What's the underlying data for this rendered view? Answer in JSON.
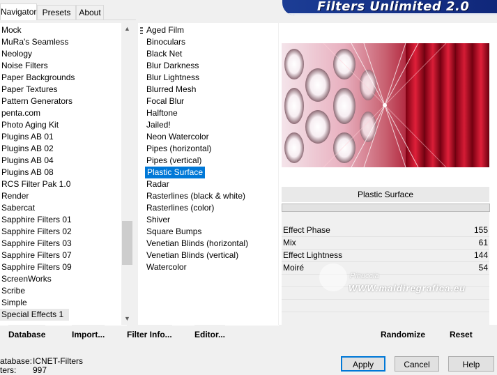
{
  "tabs": [
    {
      "label": "Navigator",
      "active": true
    },
    {
      "label": "Presets",
      "active": false
    },
    {
      "label": "About",
      "active": false
    }
  ],
  "banner_title": "Filters Unlimited 2.0",
  "categories": [
    "Mock",
    "MuRa's Seamless",
    "Neology",
    "Noise Filters",
    "Paper Backgrounds",
    "Paper Textures",
    "Pattern Generators",
    "penta.com",
    "Photo Aging Kit",
    "Plugins AB 01",
    "Plugins AB 02",
    "Plugins AB 04",
    "Plugins AB 08",
    "RCS Filter Pak 1.0",
    "Render",
    "Sabercat",
    "Sapphire Filters 01",
    "Sapphire Filters 02",
    "Sapphire Filters 03",
    "Sapphire Filters 07",
    "Sapphire Filters 09",
    "ScreenWorks",
    "Scribe",
    "Simple",
    "Special Effects 1"
  ],
  "selected_category": "Special Effects 1",
  "filters": [
    "Aged Film",
    "Binoculars",
    "Black Net",
    "Blur Darkness",
    "Blur Lightness",
    "Blurred Mesh",
    "Focal Blur",
    "Halftone",
    "Jailed!",
    "Neon Watercolor",
    "Pipes (horizontal)",
    "Pipes (vertical)",
    "Plastic Surface",
    "Radar",
    "Rasterlines (black & white)",
    "Rasterlines (color)",
    "Shiver",
    "Square Bumps",
    "Venetian Blinds (horizontal)",
    "Venetian Blinds (vertical)",
    "Watercolor"
  ],
  "selected_filter": "Plastic Surface",
  "filter_name": "Plastic Surface",
  "params": [
    {
      "label": "Effect Phase",
      "value": "155"
    },
    {
      "label": "Mix",
      "value": "61"
    },
    {
      "label": "Effect Lightness",
      "value": "144"
    },
    {
      "label": "Moiré",
      "value": "54"
    }
  ],
  "buttons": {
    "database": "Database",
    "import": "Import...",
    "filter_info": "Filter Info...",
    "editor": "Editor...",
    "randomize": "Randomize",
    "reset": "Reset",
    "apply": "Apply",
    "cancel": "Cancel",
    "help": "Help"
  },
  "status": {
    "database_label": "atabase:",
    "database_value": "ICNET-Filters",
    "filters_label": "ters:",
    "filters_value": "997"
  },
  "watermark": {
    "line1": "Pinuccia",
    "line2": "WWW.maldiregrafica.eu"
  },
  "colors": {
    "selection_blue": "#0078d7",
    "banner_blue": "#1c3d95",
    "preview_red": "#c8102e"
  }
}
